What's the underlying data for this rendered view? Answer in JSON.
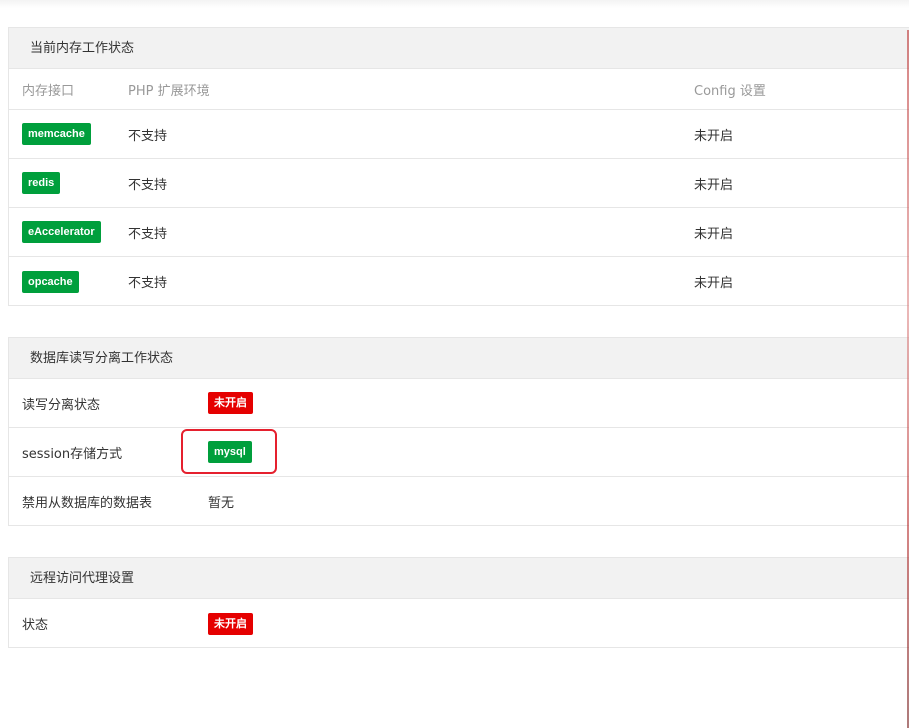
{
  "memory": {
    "title": "当前内存工作状态",
    "headers": [
      "内存接口",
      "PHP 扩展环境",
      "Config 设置"
    ],
    "rows": [
      {
        "name": "memcache",
        "php": "不支持",
        "config": "未开启"
      },
      {
        "name": "redis",
        "php": "不支持",
        "config": "未开启"
      },
      {
        "name": "eAccelerator",
        "php": "不支持",
        "config": "未开启"
      },
      {
        "name": "opcache",
        "php": "不支持",
        "config": "未开启"
      }
    ]
  },
  "database": {
    "title": "数据库读写分离工作状态",
    "rows": [
      {
        "label": "读写分离状态",
        "value": "未开启",
        "style": "red"
      },
      {
        "label": "session存储方式",
        "value": "mysql",
        "style": "green"
      },
      {
        "label": "禁用从数据库的数据表",
        "value": "暂无",
        "style": "text"
      }
    ]
  },
  "proxy": {
    "title": "远程访问代理设置",
    "rows": [
      {
        "label": "状态",
        "value": "未开启",
        "style": "red"
      }
    ]
  },
  "colors": {
    "badge_green": "#009f3c",
    "badge_red": "#e50000",
    "highlight_border": "#e5202e",
    "header_bg": "#f2f2f2"
  }
}
